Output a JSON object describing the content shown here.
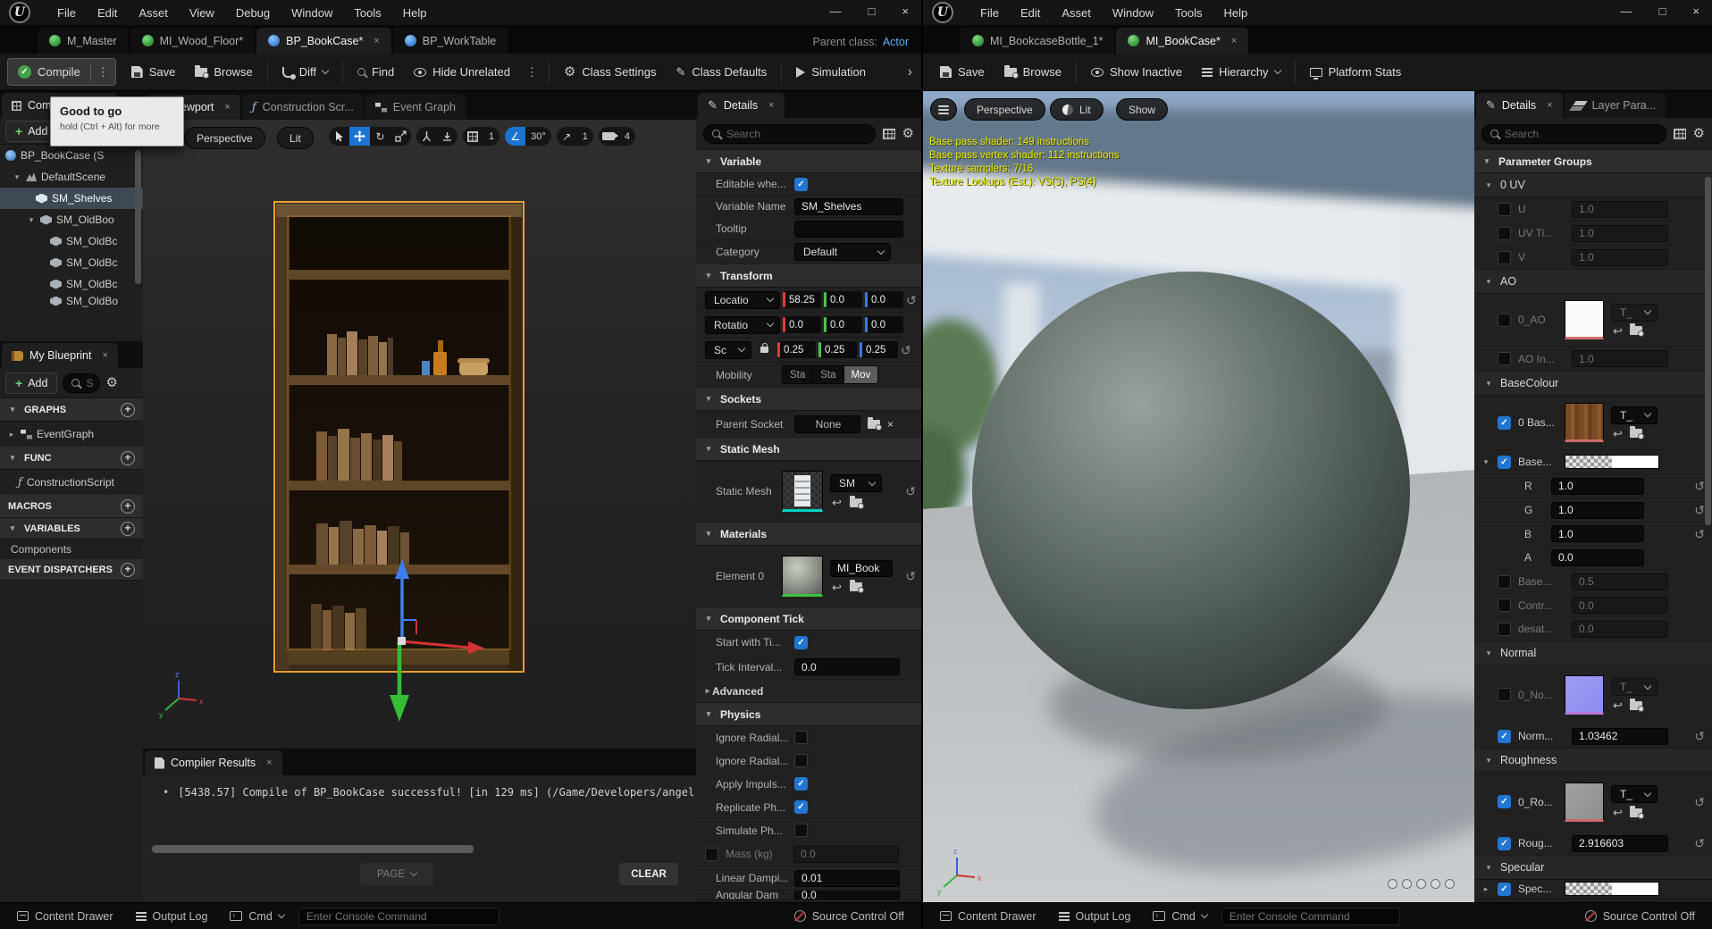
{
  "logo_glyph": "U",
  "left": {
    "menu": [
      "File",
      "Edit",
      "Asset",
      "View",
      "Debug",
      "Window",
      "Tools",
      "Help"
    ],
    "window_controls": {
      "minimize": "—",
      "maximize": "□",
      "close": "×"
    },
    "asset_tabs": [
      {
        "label": "M_Master"
      },
      {
        "label": "MI_Wood_Floor*"
      },
      {
        "label": "BP_BookCase*"
      },
      {
        "label": "BP_WorkTable"
      }
    ],
    "parent_class": {
      "label": "Parent class:",
      "value": "Actor"
    },
    "toolbar": {
      "compile": "Compile",
      "save": "Save",
      "browse": "Browse",
      "diff": "Diff",
      "find": "Find",
      "hide_unrelated": "Hide Unrelated",
      "class_settings": "Class Settings",
      "class_defaults": "Class Defaults",
      "simulation": "Simulation"
    },
    "compile_tooltip": {
      "title": "Good to go",
      "hint": "hold (Ctrl + Alt) for more"
    },
    "components_panel": {
      "title": "Components",
      "add_label": "Add",
      "tree": [
        {
          "label": "BP_BookCase (S"
        },
        {
          "label": "DefaultScene"
        },
        {
          "label": "SM_Shelves"
        },
        {
          "label": "SM_OldBoo"
        },
        {
          "label": "SM_OldBc"
        },
        {
          "label": "SM_OldBc"
        },
        {
          "label": "SM_OldBc"
        },
        {
          "label": "SM_OldBo"
        }
      ]
    },
    "my_blueprint": {
      "title": "My Blueprint",
      "add_label": "Add",
      "search_hint": "S",
      "graphs_label": "GRAPHS",
      "eventgraph_label": "EventGraph",
      "functions_label": "FUNC",
      "construction_label": "ConstructionScript",
      "macros_label": "MACROS",
      "variables_label": "VARIABLES",
      "variables_category": "Components",
      "dispatchers_label": "EVENT DISPATCHERS"
    },
    "center_tabs": {
      "viewport": "Viewport",
      "construction": "Construction Scr...",
      "event_graph": "Event Graph"
    },
    "viewport": {
      "perspective": "Perspective",
      "lit": "Lit",
      "grid_snap": "1",
      "angle_snap": "30°",
      "scale_snap": "1",
      "camera_speed": "4"
    },
    "compiler": {
      "title": "Compiler Results",
      "message": "[5438.57] Compile of BP_BookCase successful! [in 129 ms] (/Game/Developers/angel",
      "page_label": "PAGE",
      "clear_label": "CLEAR"
    },
    "details": {
      "title": "Details",
      "search_placeholder": "Search",
      "variable_header": "Variable",
      "editable_label": "Editable whe...",
      "variable_name_label": "Variable Name",
      "variable_name_value": "SM_Shelves",
      "tooltip_label": "Tooltip",
      "category_label": "Category",
      "category_value": "Default",
      "transform_header": "Transform",
      "location_label": "Locatio",
      "loc": [
        "58.25",
        "0.0",
        "0.0"
      ],
      "rotation_label": "Rotatio",
      "rot": [
        "0.0",
        "0.0",
        "0.0"
      ],
      "scale_label": "Sc",
      "scl": [
        "0.25",
        "0.25",
        "0.25"
      ],
      "mobility_label": "Mobility",
      "mobility": [
        "Sta",
        "Sta",
        "Mov"
      ],
      "sockets_header": "Sockets",
      "parent_socket_label": "Parent Socket",
      "parent_socket_value": "None",
      "static_mesh_header": "Static Mesh",
      "static_mesh_label": "Static Mesh",
      "static_mesh_value": "SM",
      "materials_header": "Materials",
      "element_label": "Element 0",
      "element_value": "MI_Book",
      "tick_header": "Component Tick",
      "start_tick_label": "Start with Ti...",
      "tick_interval_label": "Tick Interval...",
      "tick_interval_value": "0.0",
      "advanced_label": "Advanced",
      "physics_header": "Physics",
      "physics_rows": [
        {
          "label": "Ignore Radial..."
        },
        {
          "label": "Ignore Radial..."
        },
        {
          "label": "Apply Impuls..."
        },
        {
          "label": "Replicate Ph..."
        },
        {
          "label": "Simulate Ph..."
        },
        {
          "label": "Mass (kg)",
          "value": "0.0"
        },
        {
          "label": "Linear Dampi...",
          "value": "0.01"
        },
        {
          "label": "Angular Dam",
          "value": "0.0"
        }
      ]
    },
    "statusbar": {
      "content_drawer": "Content Drawer",
      "output_log": "Output Log",
      "cmd": "Cmd",
      "console_placeholder": "Enter Console Command",
      "source_control": "Source Control Off"
    }
  },
  "right": {
    "menu": [
      "File",
      "Edit",
      "Asset",
      "Window",
      "Tools",
      "Help"
    ],
    "window_controls": {
      "minimize": "—",
      "maximize": "□",
      "close": "×"
    },
    "asset_tabs": [
      {
        "label": "MI_BookcaseBottle_1*"
      },
      {
        "label": "MI_BookCase*"
      }
    ],
    "toolbar": {
      "save": "Save",
      "browse": "Browse",
      "show_inactive": "Show Inactive",
      "hierarchy": "Hierarchy",
      "platform_stats": "Platform Stats"
    },
    "viewport": {
      "perspective": "Perspective",
      "lit": "Lit",
      "show": "Show",
      "stats": [
        "Base pass shader: 149 instructions",
        "Base pass vertex shader: 112 instructions",
        "Texture samplers: 7/16",
        "Texture Lookups (Est.): VS(3), PS(4)"
      ]
    },
    "details": {
      "title": "Details",
      "layer_tab": "Layer Para...",
      "search_placeholder": "Search",
      "param_groups_header": "Parameter Groups",
      "uv": {
        "name": "0 UV",
        "u_label": "U",
        "u_value": "1.0",
        "uvti_label": "UV Ti...",
        "uvti_value": "1.0",
        "v_label": "V",
        "v_value": "1.0"
      },
      "ao": {
        "name": "AO",
        "tex_label": "0_AO",
        "tex_dropdown": "T_",
        "intensity_label": "AO In...",
        "intensity_value": "1.0"
      },
      "basecolour": {
        "name": "BaseColour",
        "tex_label": "0 Bas...",
        "tex_dropdown": "T_",
        "tint_label": "Base...",
        "r_label": "R",
        "r_value": "1.0",
        "g_label": "G",
        "g_value": "1.0",
        "b_label": "B",
        "b_value": "1.0",
        "a_label": "A",
        "a_value": "0.0",
        "power_label": "Base...",
        "power_value": "0.5",
        "contrast_label": "Contr...",
        "contrast_value": "0.0",
        "desat_label": "desat...",
        "desat_value": "0.0"
      },
      "normal": {
        "name": "Normal",
        "tex_label": "0_No...",
        "tex_dropdown": "T_",
        "flatten_label": "Norm...",
        "flatten_value": "1.03462"
      },
      "roughness": {
        "name": "Roughness",
        "tex_label": "0_Ro...",
        "tex_dropdown": "T_",
        "power_label": "Roug...",
        "power_value": "2.916603"
      },
      "specular": {
        "name": "Specular",
        "label": "Spec..."
      }
    },
    "statusbar": {
      "content_drawer": "Content Drawer",
      "output_log": "Output Log",
      "cmd": "Cmd",
      "console_placeholder": "Enter Console Command",
      "source_control": "Source Control Off"
    }
  }
}
